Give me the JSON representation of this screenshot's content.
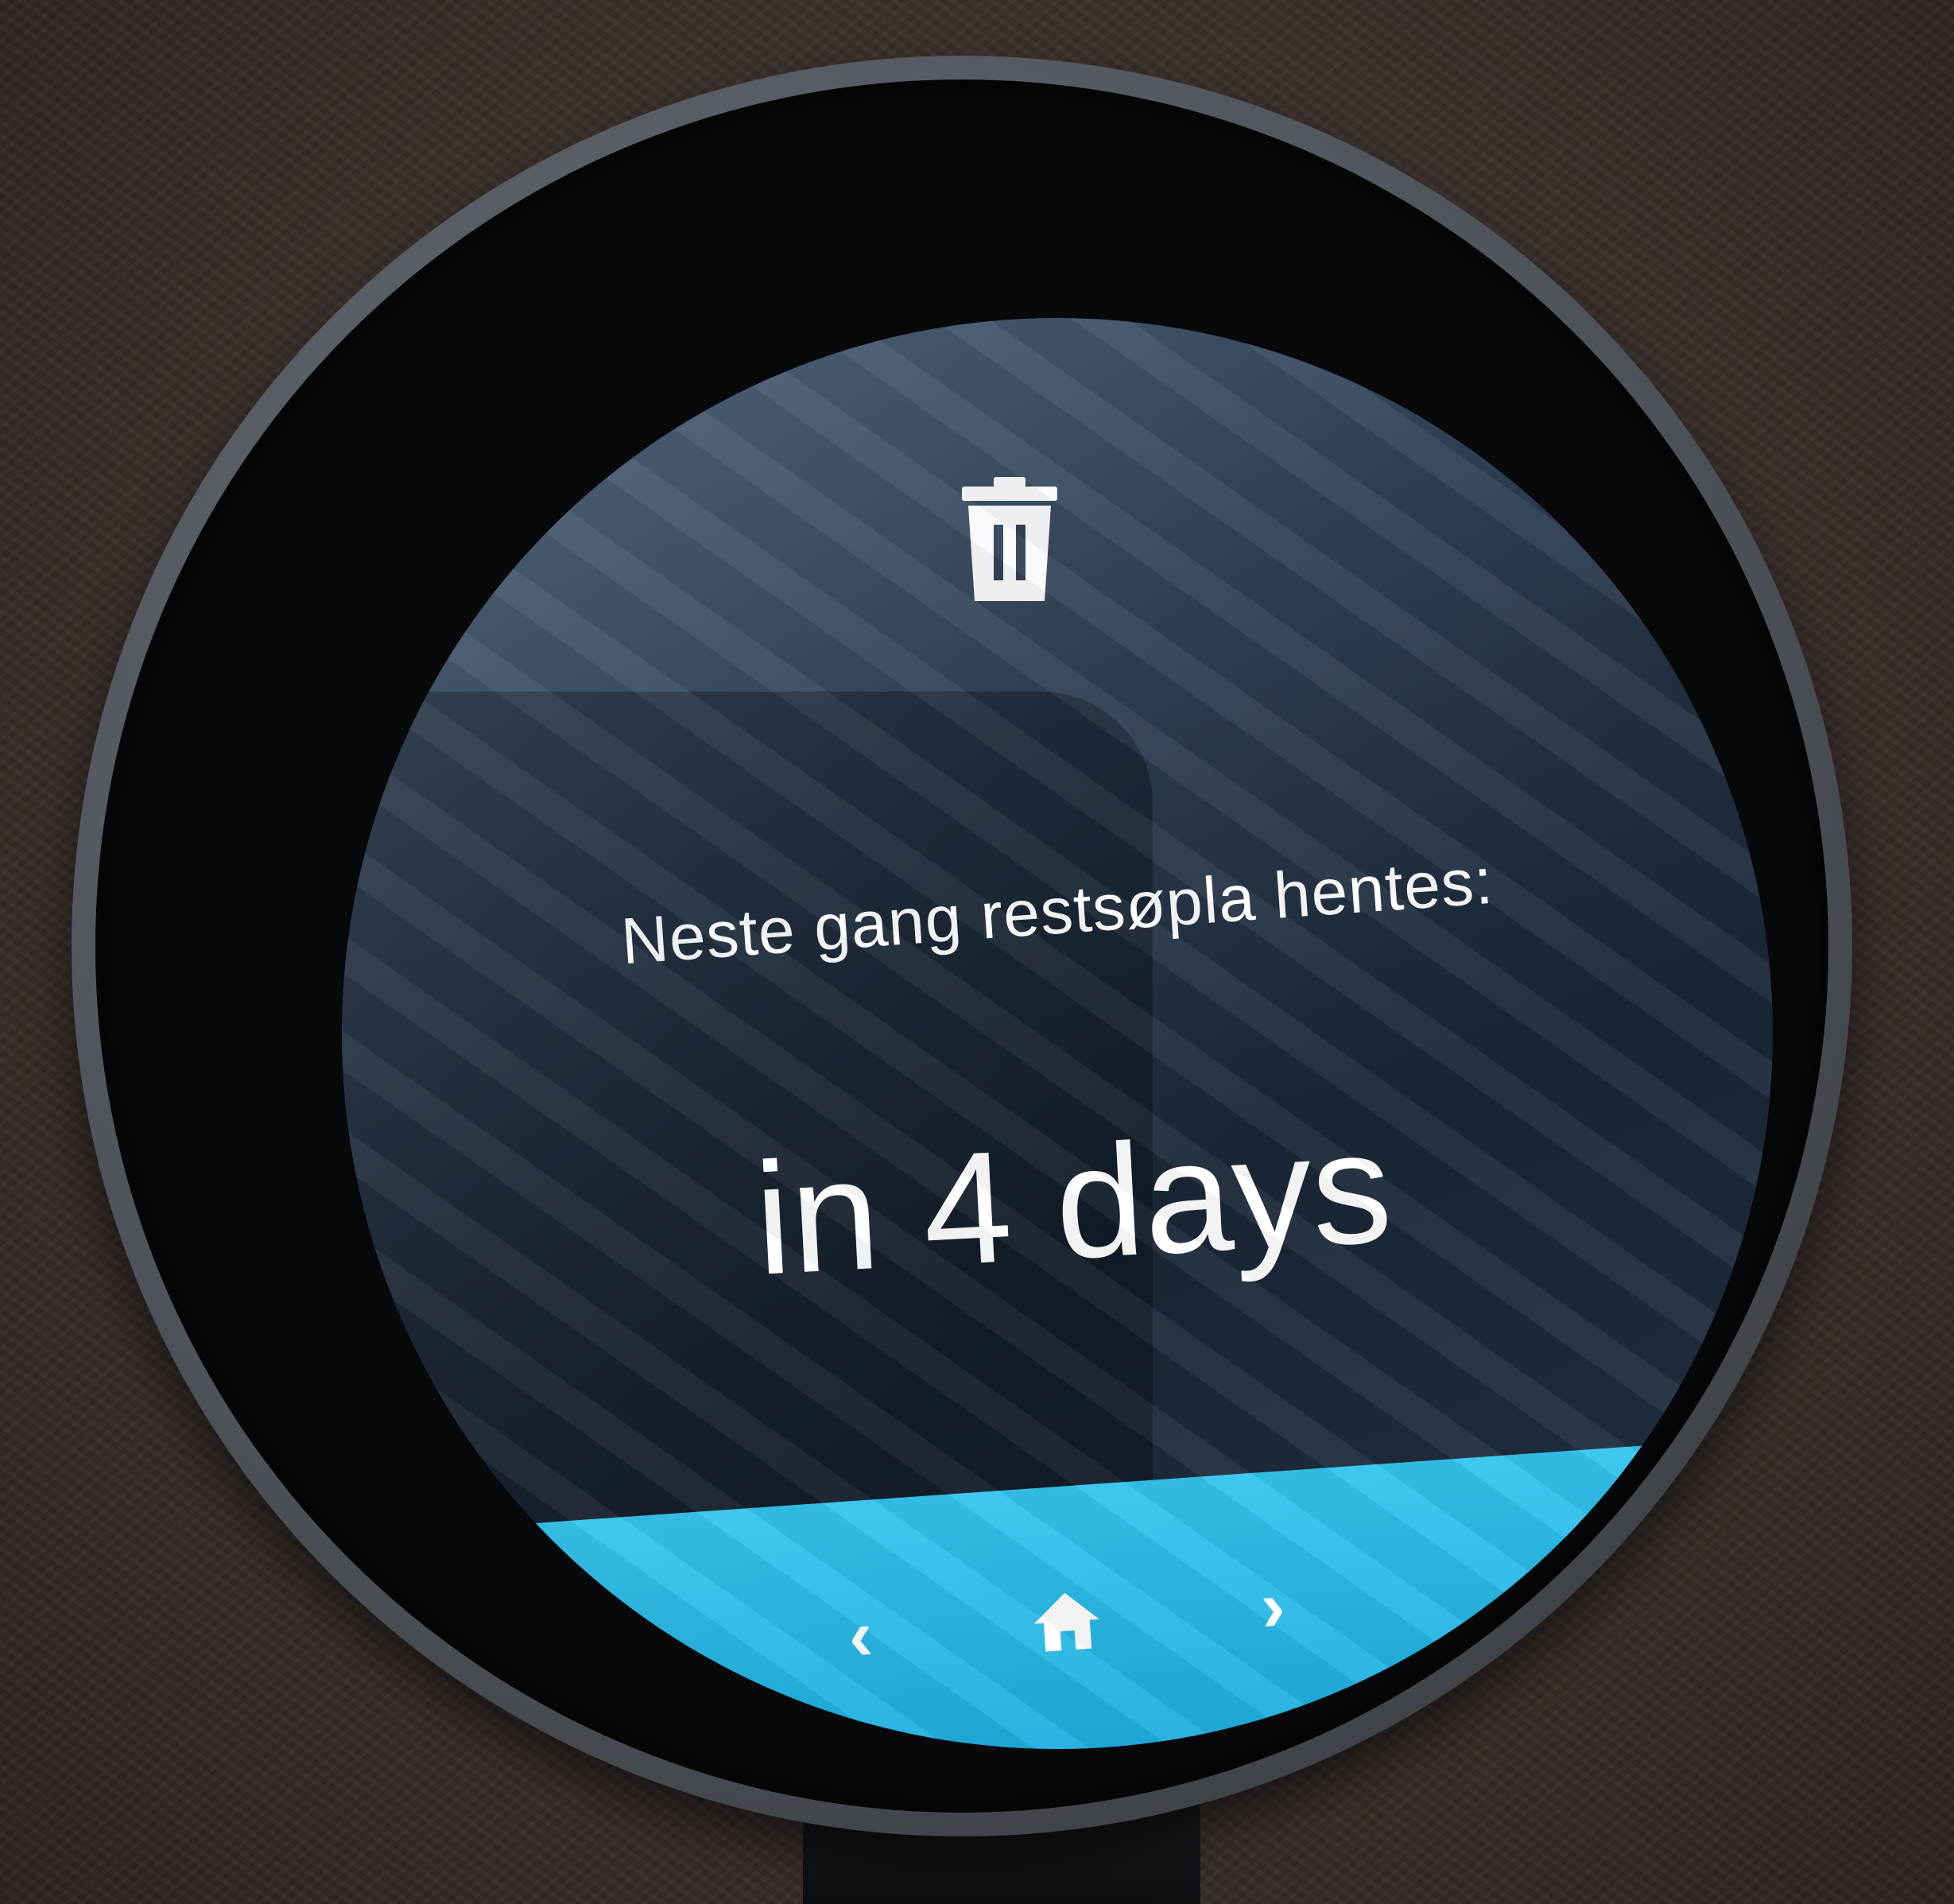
{
  "card": {
    "icon": "trash-icon",
    "title": "Neste gang restsøpla hentes:",
    "value": "in 4 days"
  },
  "navbar": {
    "prev_icon": "chevron-left-icon",
    "prev_glyph": "‹",
    "home_icon": "home-icon",
    "next_icon": "chevron-right-icon",
    "next_glyph": "›",
    "accent_color": "#2ab8e8"
  }
}
